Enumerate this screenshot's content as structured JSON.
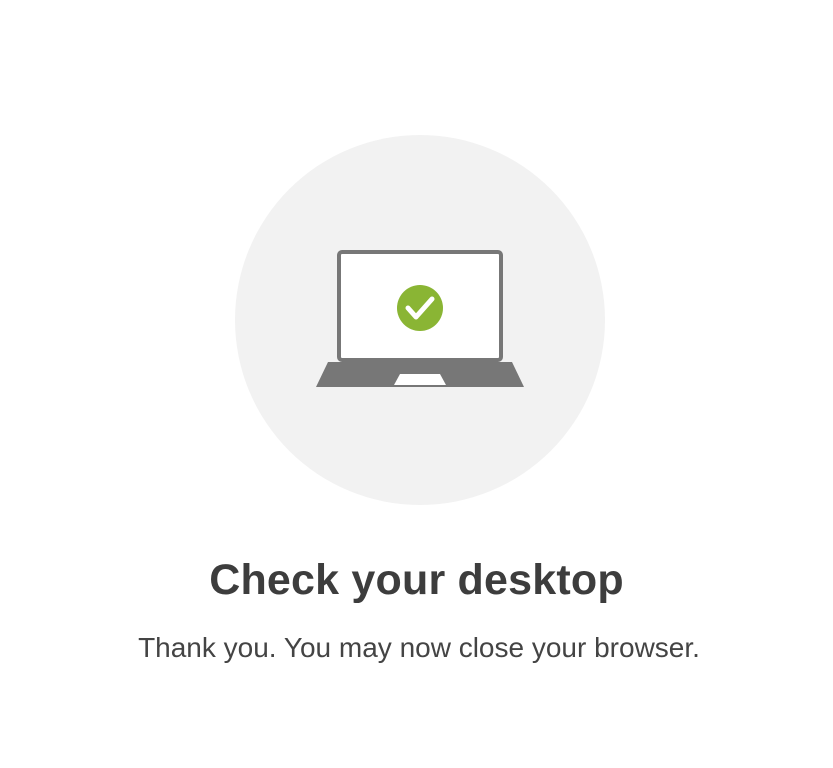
{
  "illustration": {
    "icon": "laptop-check-icon",
    "circle_color": "#f2f2f2",
    "laptop_color": "#777777",
    "check_color": "#8ab534"
  },
  "message": {
    "title": "Check your desktop",
    "body": "Thank you. You may now close your browser."
  }
}
